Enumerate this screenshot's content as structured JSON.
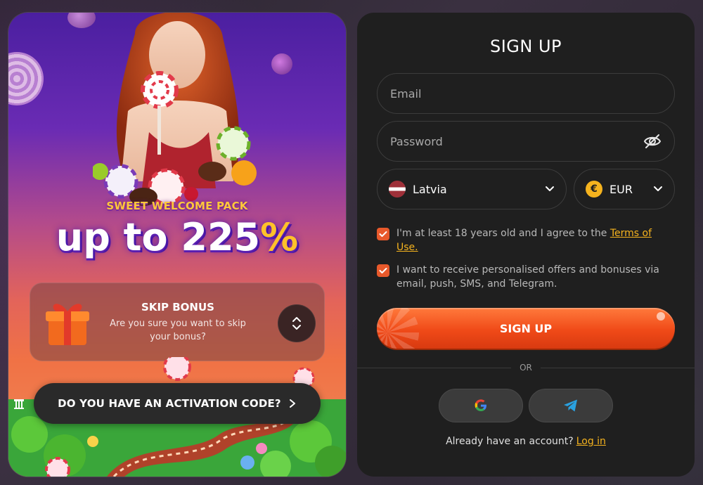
{
  "promo": {
    "label": "SWEET WELCOME PACK",
    "value_prefix": "up to 225",
    "value_suffix": "%",
    "skip": {
      "title": "SKIP BONUS",
      "description": "Are you sure you want to skip your bonus?"
    },
    "activation_label": "DO YOU HAVE AN ACTIVATION CODE?"
  },
  "form": {
    "title": "SIGN UP",
    "email_placeholder": "Email",
    "password_placeholder": "Password",
    "country": "Latvia",
    "currency": "EUR",
    "currency_symbol": "€",
    "age_text": "I'm at least 18 years old and I agree to the",
    "terms_link": "Terms of Use.",
    "offers_text": "I want to receive personalised offers and bonuses via email, push, SMS, and Telegram.",
    "age_checked": true,
    "offers_checked": true,
    "submit_label": "SIGN UP",
    "or_label": "OR",
    "login_prompt": "Already have an account?",
    "login_link": "Log in"
  },
  "icons": {
    "eye": "eye-off-icon",
    "chevron": "chevron-down-icon",
    "google": "google-icon",
    "telegram": "telegram-icon",
    "skip_toggle": "expand-icon"
  },
  "colors": {
    "accent": "#f04a18",
    "link": "#f5b31e",
    "panel": "#1f1f1f",
    "promo_gold": "#ffc12a"
  }
}
